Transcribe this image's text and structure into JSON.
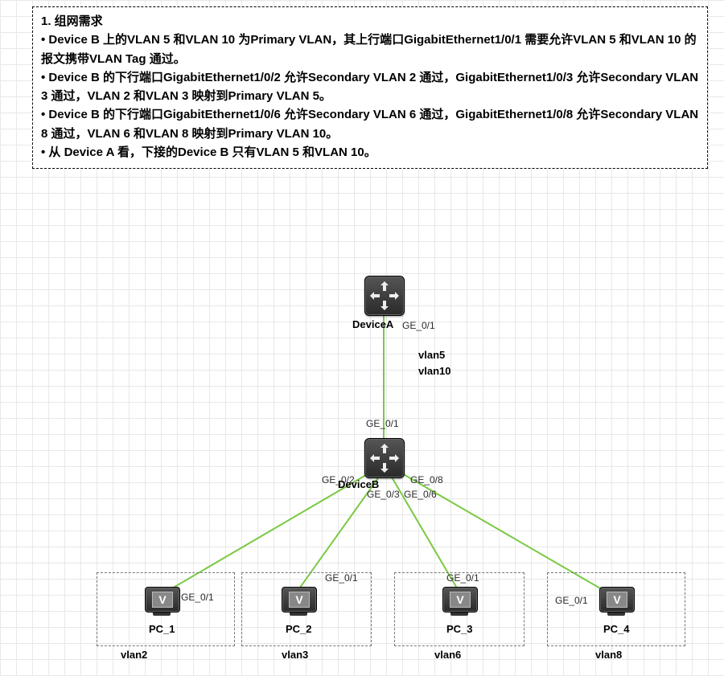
{
  "note": {
    "line1": "1. 组网需求",
    "line2": "• Device B 上的VLAN 5 和VLAN 10 为Primary VLAN，其上行端口GigabitEthernet1/0/1 需要允许VLAN 5 和VLAN 10 的报文携带VLAN Tag 通过。",
    "line3": "• Device B 的下行端口GigabitEthernet1/0/2 允许Secondary VLAN 2 通过，GigabitEthernet1/0/3 允许Secondary VLAN 3 通过，VLAN 2 和VLAN 3 映射到Primary VLAN 5。",
    "line4": "• Device B 的下行端口GigabitEthernet1/0/6 允许Secondary VLAN 6 通过，GigabitEthernet1/0/8 允许Secondary VLAN 8 通过，VLAN 6 和VLAN 8 映射到Primary VLAN 10。",
    "line5": "• 从 Device A 看，下接的Device B 只有VLAN 5 和VLAN 10。"
  },
  "deviceA": {
    "label": "DeviceA",
    "port_down": "GE_0/1"
  },
  "trunk": {
    "vlan5": "vlan5",
    "vlan10": "vlan10"
  },
  "deviceB": {
    "label": "DeviceB",
    "port_up": "GE_0/1",
    "port_02": "GE_0/2",
    "port_03": "GE_0/3",
    "port_06": "GE_0/6",
    "port_08": "GE_0/8"
  },
  "pc1": {
    "label": "PC_1",
    "port": "GE_0/1",
    "vlan": "vlan2"
  },
  "pc2": {
    "label": "PC_2",
    "port": "GE_0/1",
    "vlan": "vlan3"
  },
  "pc3": {
    "label": "PC_3",
    "port": "GE_0/1",
    "vlan": "vlan6"
  },
  "pc4": {
    "label": "PC_4",
    "port": "GE_0/1",
    "vlan": "vlan8"
  }
}
